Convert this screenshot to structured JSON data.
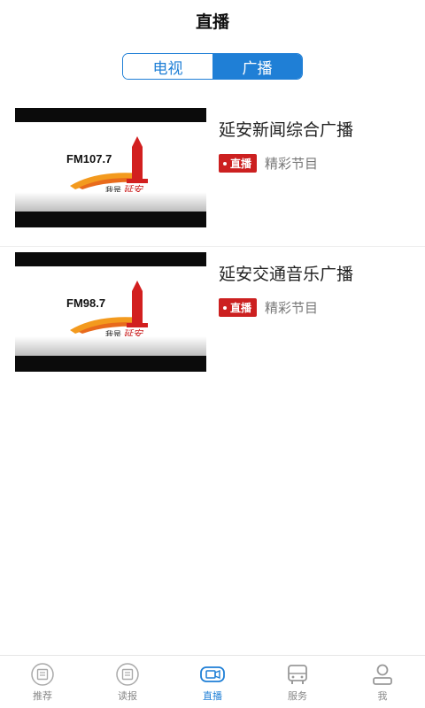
{
  "header": {
    "title": "直播"
  },
  "segment": {
    "tabs": [
      "电视",
      "广播"
    ],
    "active_index": 1
  },
  "stations": [
    {
      "logo_text": "FM107.7",
      "slogan_prefix": "我是",
      "slogan_city": "延安",
      "name": "延安新闻综合广播",
      "badge": "直播",
      "subtitle": "精彩节目"
    },
    {
      "logo_text": "FM98.7",
      "slogan_prefix": "我是",
      "slogan_city": "延安",
      "name": "延安交通音乐广播",
      "badge": "直播",
      "subtitle": "精彩节目"
    }
  ],
  "tabbar": {
    "items": [
      {
        "label": "推荐",
        "icon": "recommend-icon"
      },
      {
        "label": "读报",
        "icon": "newspaper-icon"
      },
      {
        "label": "直播",
        "icon": "live-camera-icon"
      },
      {
        "label": "服务",
        "icon": "bus-icon"
      },
      {
        "label": "我",
        "icon": "user-icon"
      }
    ],
    "active_index": 2
  },
  "colors": {
    "accent": "#1f7fd6",
    "badge": "#cc2020",
    "logo_red": "#d21f1f",
    "logo_orange": "#f39a1e"
  }
}
